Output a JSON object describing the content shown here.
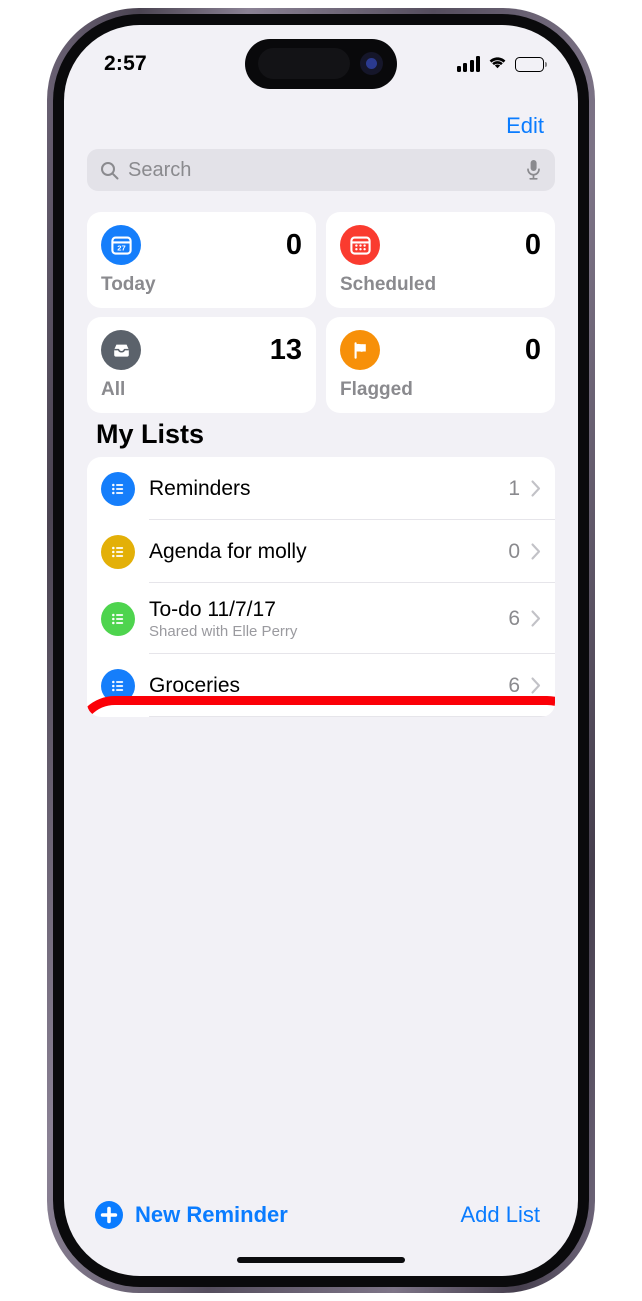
{
  "status_bar": {
    "time": "2:57",
    "cellular_icon": "cellular-signal-icon",
    "wifi_icon": "wifi-icon",
    "battery_icon": "battery-full-icon"
  },
  "nav": {
    "edit_label": "Edit"
  },
  "search": {
    "placeholder": "Search",
    "value": "",
    "search_icon": "search-icon",
    "mic_icon": "microphone-icon"
  },
  "smart_lists": [
    {
      "label": "Today",
      "count": "0",
      "icon": "calendar-day-icon",
      "color": "#157efb"
    },
    {
      "label": "Scheduled",
      "count": "0",
      "icon": "calendar-grid-icon",
      "color": "#fa3b2f"
    },
    {
      "label": "All",
      "count": "13",
      "icon": "inbox-tray-icon",
      "color": "#5b626b"
    },
    {
      "label": "Flagged",
      "count": "0",
      "icon": "flag-icon",
      "color": "#f79009"
    }
  ],
  "my_lists": {
    "header": "My Lists",
    "items": [
      {
        "title": "Reminders",
        "subtitle": "",
        "count": "1",
        "icon": "bulleted-list-icon",
        "color": "#157efb"
      },
      {
        "title": "Agenda for molly",
        "subtitle": "",
        "count": "0",
        "icon": "bulleted-list-icon",
        "color": "#e3b008"
      },
      {
        "title": "To-do 11/7/17",
        "subtitle": "Shared with Elle Perry",
        "count": "6",
        "icon": "bulleted-list-icon",
        "color": "#4ed44e"
      },
      {
        "title": "Groceries",
        "subtitle": "",
        "count": "6",
        "icon": "bulleted-list-icon",
        "color": "#157efb"
      }
    ]
  },
  "toolbar": {
    "new_reminder_label": "New Reminder",
    "add_list_label": "Add List",
    "plus_icon": "plus-circle-icon"
  },
  "annotation": {
    "target": "Groceries",
    "shape": "rounded-rectangle-outline",
    "color": "#fb0007"
  }
}
